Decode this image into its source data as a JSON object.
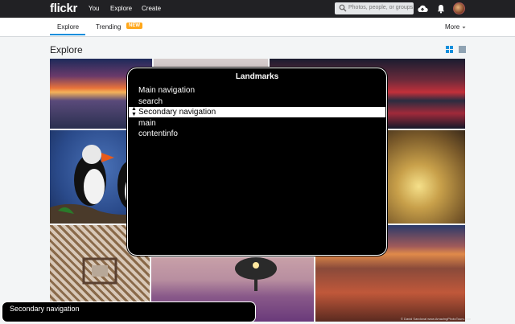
{
  "topbar": {
    "logo": "flickr",
    "nav": [
      "You",
      "Explore",
      "Create"
    ],
    "search_placeholder": "Photos, people, or groups",
    "icons": [
      "search-icon",
      "upload-cloud-icon",
      "notifications-bell-icon",
      "avatar"
    ]
  },
  "subnav": {
    "tabs": [
      {
        "label": "Explore",
        "active": true
      },
      {
        "label": "Trending",
        "badge": "NEW"
      }
    ],
    "more": "More"
  },
  "page": {
    "title": "Explore",
    "view_icons": [
      "grid-view-icon",
      "list-view-icon"
    ],
    "photos": [
      "sunset-beach",
      "misty-hills",
      "red-sky-lake",
      "puffins",
      "autumn-leaves-bokeh",
      "eiffel-tower-underside",
      "tree-sunrise-lavender",
      "canyon-sunset"
    ],
    "credit": "© David Sandoval www.AmazingPhotoTours.com"
  },
  "landmarks": {
    "title": "Landmarks",
    "items": [
      {
        "label": "Main navigation"
      },
      {
        "label": "search"
      },
      {
        "label": "Secondary navigation",
        "selected": true
      },
      {
        "label": "main"
      },
      {
        "label": "contentinfo"
      }
    ]
  },
  "caption": {
    "text": "Secondary navigation"
  },
  "colors": {
    "topbar": "#212124",
    "accent": "#128fdc",
    "badge": "#ffa71a",
    "page_bg": "#f3f5f6"
  }
}
